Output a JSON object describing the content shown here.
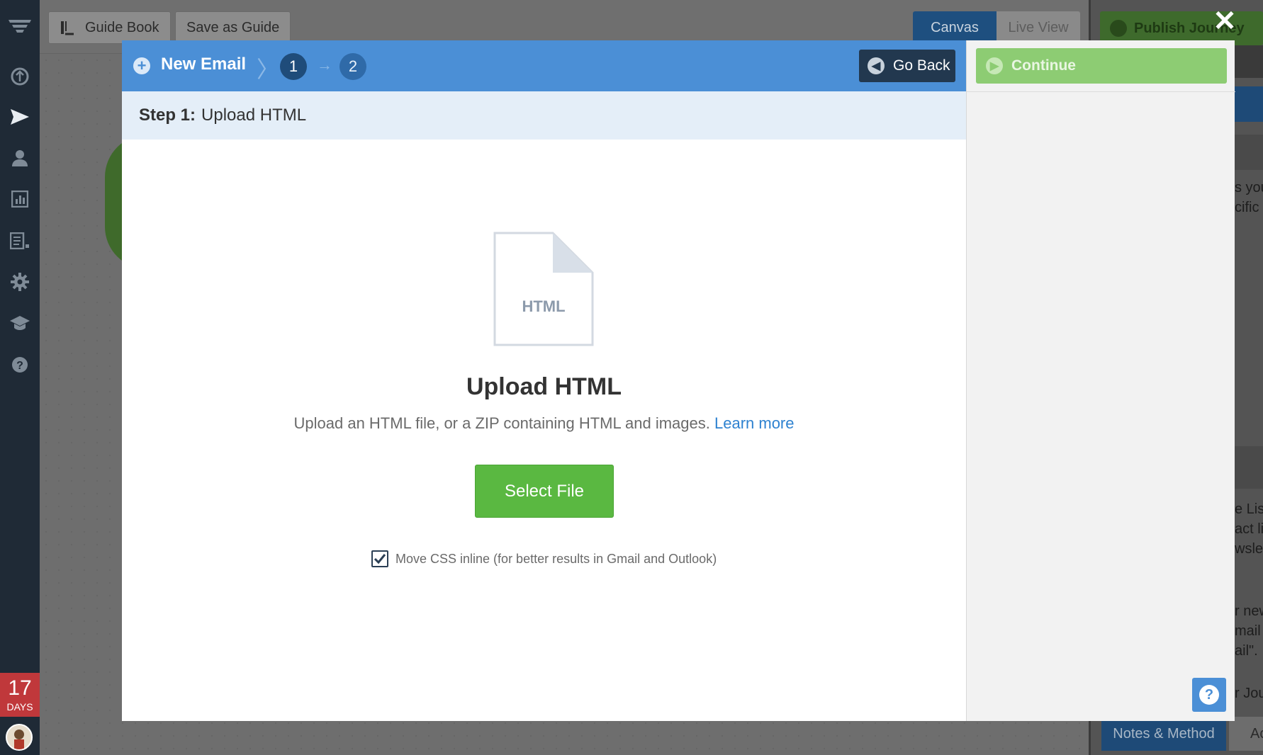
{
  "toolbar": {
    "guide_book_label": "Guide Book",
    "save_as_guide_label": "Save as Guide",
    "tab_canvas": "Canvas",
    "tab_live_view": "Live View",
    "publish_label": "Publish Journey"
  },
  "leftnav": {
    "icons": [
      "menu-icon",
      "journey-icon",
      "send-icon",
      "contacts-icon",
      "reports-icon",
      "content-icon",
      "settings-icon",
      "learn-icon",
      "help-icon"
    ],
    "trial_number": "17",
    "trial_label": "DAYS"
  },
  "modal": {
    "title": "New Email",
    "step1": "1",
    "step2": "2",
    "go_back_label": "Go Back",
    "continue_label": "Continue",
    "step_bar_bold": "Step 1:",
    "step_bar_text": "Upload HTML",
    "file_icon_label": "HTML",
    "upload_title": "Upload HTML",
    "upload_desc": "Upload an HTML file, or a ZIP containing HTML and images.",
    "learn_more": "Learn more",
    "select_file_label": "Select File",
    "inline_css_label": "Move CSS inline (for better results in Gmail and Outlook)",
    "inline_css_checked": true
  },
  "rightpanel": {
    "snippets": [
      "s you",
      "cific",
      "e List",
      "act li",
      "wslet",
      "r new",
      "mail",
      "ail\".",
      "r Jou"
    ],
    "notes_tab": "Notes & Method",
    "ac_tab": "Ac"
  },
  "colors": {
    "header_blue": "#4b8fd6",
    "continue_green": "#8dcc73",
    "select_green": "#5ab841",
    "nav_dark": "#1f2a36"
  }
}
